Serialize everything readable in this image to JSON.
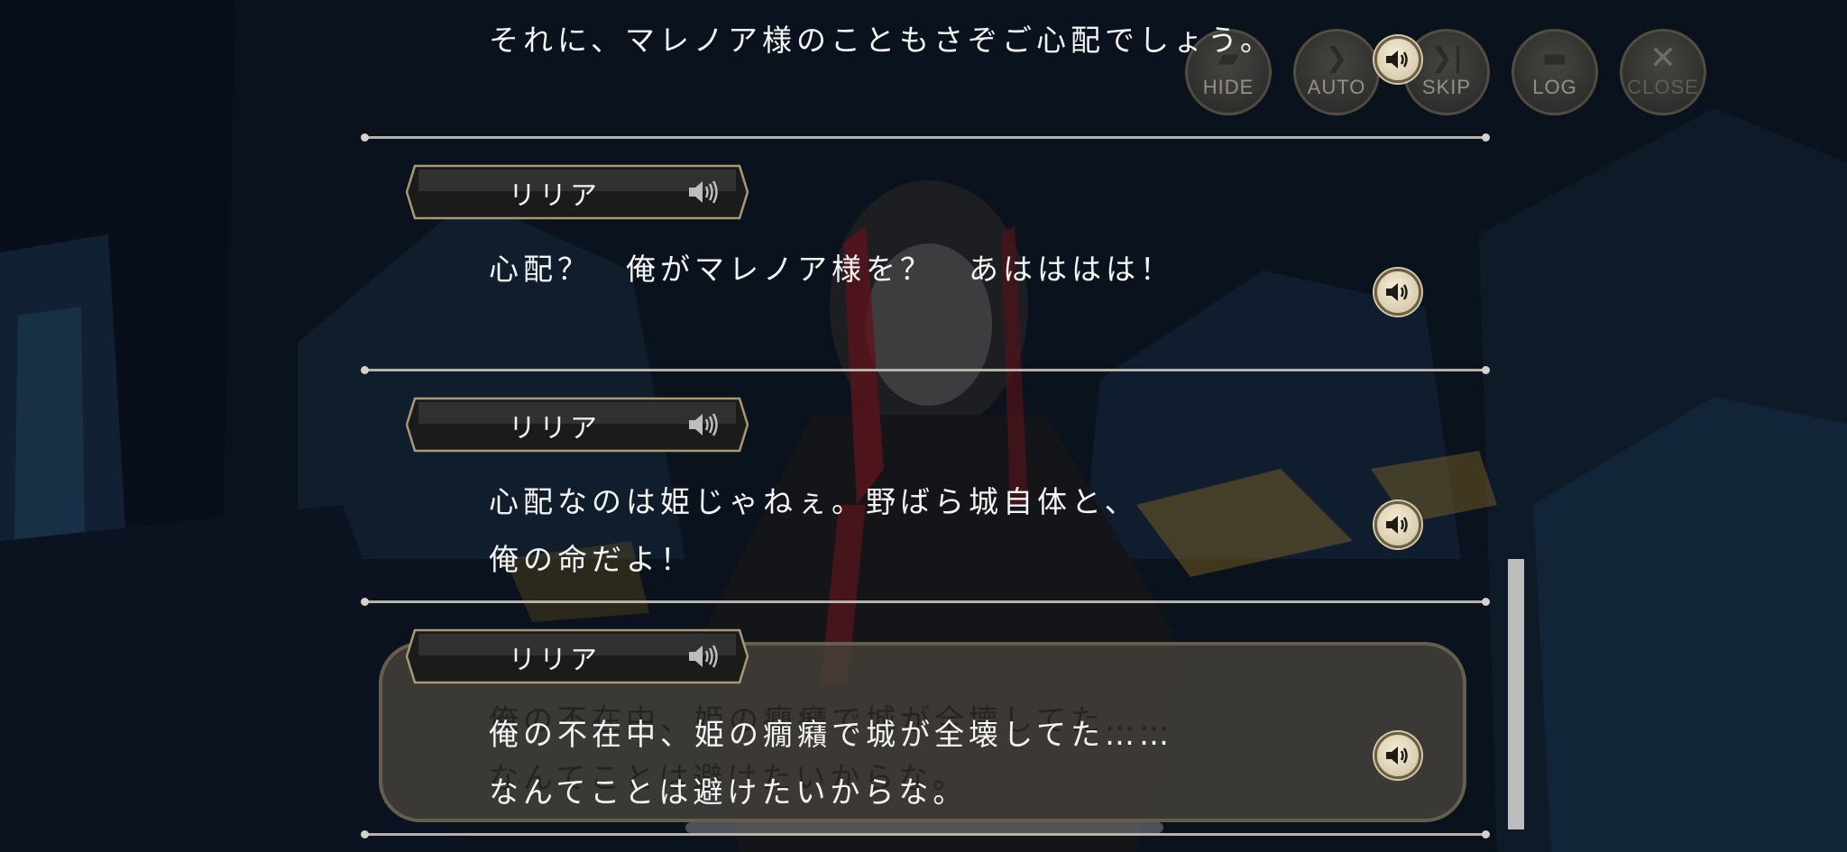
{
  "controls": [
    {
      "key": "hide",
      "label": "HIDE",
      "icon": "hide-icon"
    },
    {
      "key": "auto",
      "label": "AUTO",
      "icon": "auto-play-icon"
    },
    {
      "key": "skip",
      "label": "SKIP",
      "icon": "skip-icon"
    },
    {
      "key": "log",
      "label": "LOG",
      "icon": "log-icon"
    },
    {
      "key": "close",
      "label": "CLOSE",
      "icon": "close-icon"
    }
  ],
  "log": {
    "top_line": "それに、マレノア様のこともさぞご心配でしょう。",
    "entries": [
      {
        "speaker": "リリア",
        "lines": [
          "心配？　俺がマレノア様を？　あはははは！"
        ]
      },
      {
        "speaker": "リリア",
        "lines": [
          "心配なのは姫じゃねぇ。野ばら城自体と、",
          "俺の命だよ！"
        ]
      },
      {
        "speaker": "リリア",
        "lines": [
          "俺の不在中、姫の癇癪で城が全壊してた……",
          "なんてことは避けたいからな。"
        ]
      }
    ],
    "background_window_text": [
      "俺の不在中、姫の癇癪で城が全壊してた……",
      "なんてことは避けたいからな。"
    ]
  },
  "colors": {
    "accent_gold": "#cdbf9c",
    "plate_border": "#a99a73",
    "text": "#f4f4f4"
  }
}
